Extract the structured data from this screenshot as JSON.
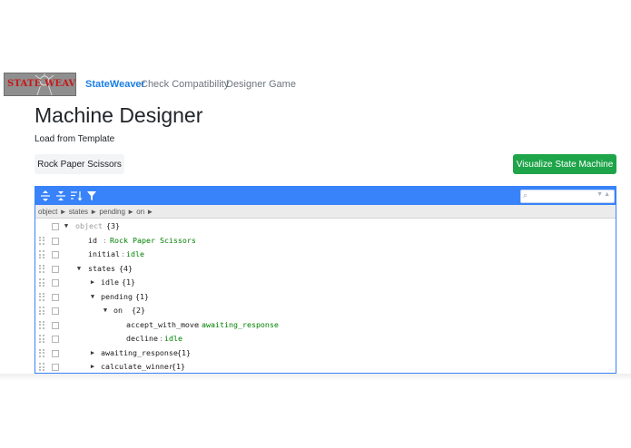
{
  "nav": {
    "logo_text": "STATE WEAVER",
    "brand": "StateWeaver",
    "links": [
      "Check Compatibility",
      "Designer",
      "Game"
    ]
  },
  "page": {
    "title": "Machine Designer",
    "subtitle": "Load from Template",
    "template_button": "Rock Paper Scissors",
    "visualize_button": "Visualize State Machine"
  },
  "editor": {
    "breadcrumb": "object ► states ► pending ► on ►",
    "search": {
      "placeholder": ""
    },
    "rows": [
      {
        "expander": "▼",
        "key": "object",
        "meta": "{3}",
        "key_dim": true,
        "value": ""
      },
      {
        "expander": "",
        "key": "id",
        "meta": "",
        "value": "Rock Paper Scissors"
      },
      {
        "expander": "",
        "key": "initial",
        "meta": "",
        "value": "idle"
      },
      {
        "expander": "▼",
        "key": "states",
        "meta": "{4}",
        "value": ""
      },
      {
        "expander": "▶",
        "key": "idle",
        "meta": "{1}",
        "value": ""
      },
      {
        "expander": "▼",
        "key": "pending",
        "meta": "{1}",
        "value": ""
      },
      {
        "expander": "▼",
        "key": "on",
        "meta": "{2}",
        "value": ""
      },
      {
        "expander": "",
        "key": "accept_with_move",
        "meta": "",
        "value": "awaiting_response"
      },
      {
        "expander": "",
        "key": "decline",
        "meta": "",
        "value": "idle"
      },
      {
        "expander": "▶",
        "key": "awaiting_response",
        "meta": "{1}",
        "value": ""
      },
      {
        "expander": "▶",
        "key": "calculate_winner",
        "meta": "{1}",
        "value": ""
      }
    ]
  },
  "colors": {
    "brand": "#1a7ee6",
    "primary_green": "#1ea449",
    "editor_blue": "#3883fa",
    "value_green": "#008000"
  },
  "icons": [
    "expand-all-icon",
    "collapse-all-icon",
    "sort-icon",
    "filter-icon",
    "search-icon"
  ]
}
